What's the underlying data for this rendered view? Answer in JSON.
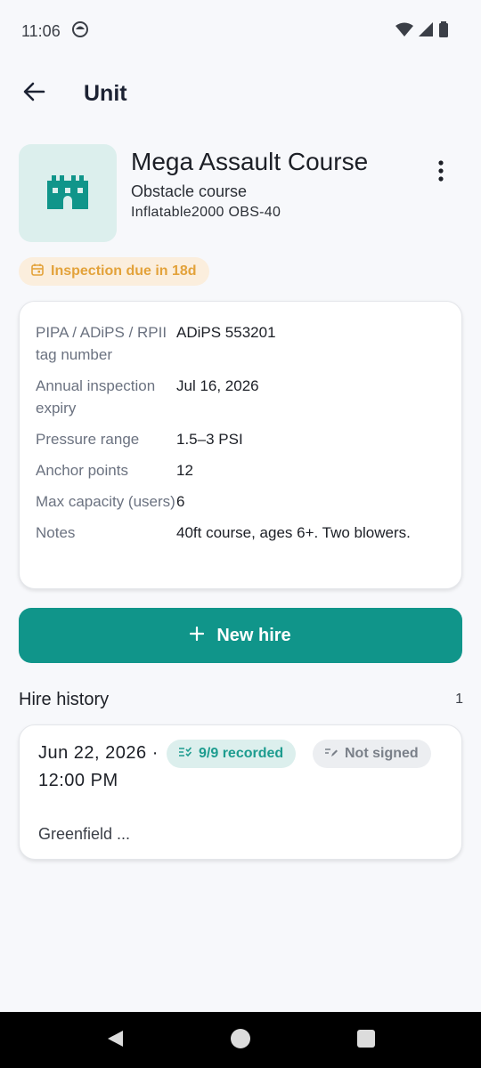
{
  "status_bar": {
    "time": "11:06",
    "icons": [
      "notification-icon",
      "wifi-icon",
      "signal-icon",
      "battery-icon"
    ]
  },
  "app_bar": {
    "title": "Unit",
    "back_icon": "arrow-back-icon"
  },
  "unit": {
    "name": "Mega Assault Course",
    "type": "Obstacle course",
    "model": "Inflatable2000 OBS-40",
    "thumb_icon": "castle-icon",
    "thumb_color": "#10958a",
    "more_icon": "more-vert-icon"
  },
  "inspection_badge": {
    "label": "Inspection due in 18d",
    "icon": "calendar-icon",
    "color": "#e3a23a"
  },
  "details": [
    {
      "label": "PIPA / ADiPS / RPII tag number",
      "value": "ADiPS 553201"
    },
    {
      "label": "Annual inspection expiry",
      "value": "Jul 16, 2026"
    },
    {
      "label": "Pressure range",
      "value": "1.5–3 PSI"
    },
    {
      "label": "Anchor points",
      "value": "12"
    },
    {
      "label": "Max capacity (users)",
      "value": "6"
    },
    {
      "label": "Notes",
      "value": "40ft course, ages 6+. Two blowers."
    }
  ],
  "new_hire_button": {
    "label": "New hire",
    "icon": "plus-icon",
    "color": "#10958a"
  },
  "hire_history": {
    "title": "Hire history",
    "count": "1",
    "items": [
      {
        "date": "Jun 22, 2026 · 12:00 PM",
        "location": "Greenfield ...",
        "recorded_chip": "9/9 recorded",
        "signed_chip": "Not signed"
      }
    ]
  },
  "nav_bar": {
    "icons": [
      "nav-back-icon",
      "nav-home-icon",
      "nav-recents-icon"
    ]
  }
}
